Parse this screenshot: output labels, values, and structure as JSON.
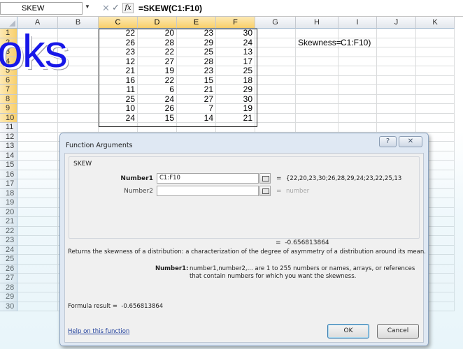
{
  "formula_bar": {
    "name_box": "SKEW",
    "fx_label": "fx",
    "cancel_glyph": "✕",
    "enter_glyph": "✓",
    "formula": "=SKEW(C1:F10)"
  },
  "sheet": {
    "columns": [
      "A",
      "B",
      "C",
      "D",
      "E",
      "F",
      "G",
      "H",
      "I",
      "J",
      "K"
    ],
    "rows": [
      "1",
      "2",
      "3",
      "4",
      "5",
      "6",
      "7",
      "8",
      "9",
      "10",
      "11",
      "12",
      "13",
      "14",
      "15",
      "16",
      "17",
      "18",
      "19",
      "20",
      "21",
      "22",
      "23",
      "24",
      "25",
      "26",
      "27",
      "28",
      "29",
      "30"
    ],
    "data": [
      [
        22,
        20,
        23,
        30
      ],
      [
        26,
        28,
        29,
        24
      ],
      [
        23,
        22,
        25,
        13
      ],
      [
        12,
        27,
        28,
        17
      ],
      [
        21,
        19,
        23,
        25
      ],
      [
        16,
        22,
        15,
        18
      ],
      [
        11,
        6,
        21,
        29
      ],
      [
        25,
        24,
        27,
        30
      ],
      [
        10,
        26,
        7,
        19
      ],
      [
        24,
        15,
        14,
        21
      ]
    ],
    "label_cell": "Skewness=",
    "formula_cell": "C1:F10)"
  },
  "watermark_text": "oks",
  "dialog": {
    "title": "Function Arguments",
    "help_glyph": "?",
    "close_glyph": "✕",
    "function_name": "SKEW",
    "arg1_label": "Number1",
    "arg1_value": "C1:F10",
    "arg1_preview": "{22,20,23,30;26,28,29,24;23,22,25,13",
    "arg2_label": "Number2",
    "arg2_value": "",
    "arg2_preview": "number",
    "equals": "=",
    "result_preview": "-0.656813864",
    "description": "Returns the skewness of a distribution: a characterization of the degree of asymmetry of a distribution around its mean.",
    "arg_desc_name": "Number1:",
    "arg_desc_text": "number1,number2,... are 1 to 255 numbers or names, arrays, or references that contain numbers for which you want the skewness.",
    "formula_result_label": "Formula result =",
    "formula_result_value": "-0.656813864",
    "help_link": "Help on this function",
    "ok_label": "OK",
    "cancel_label": "Cancel"
  }
}
